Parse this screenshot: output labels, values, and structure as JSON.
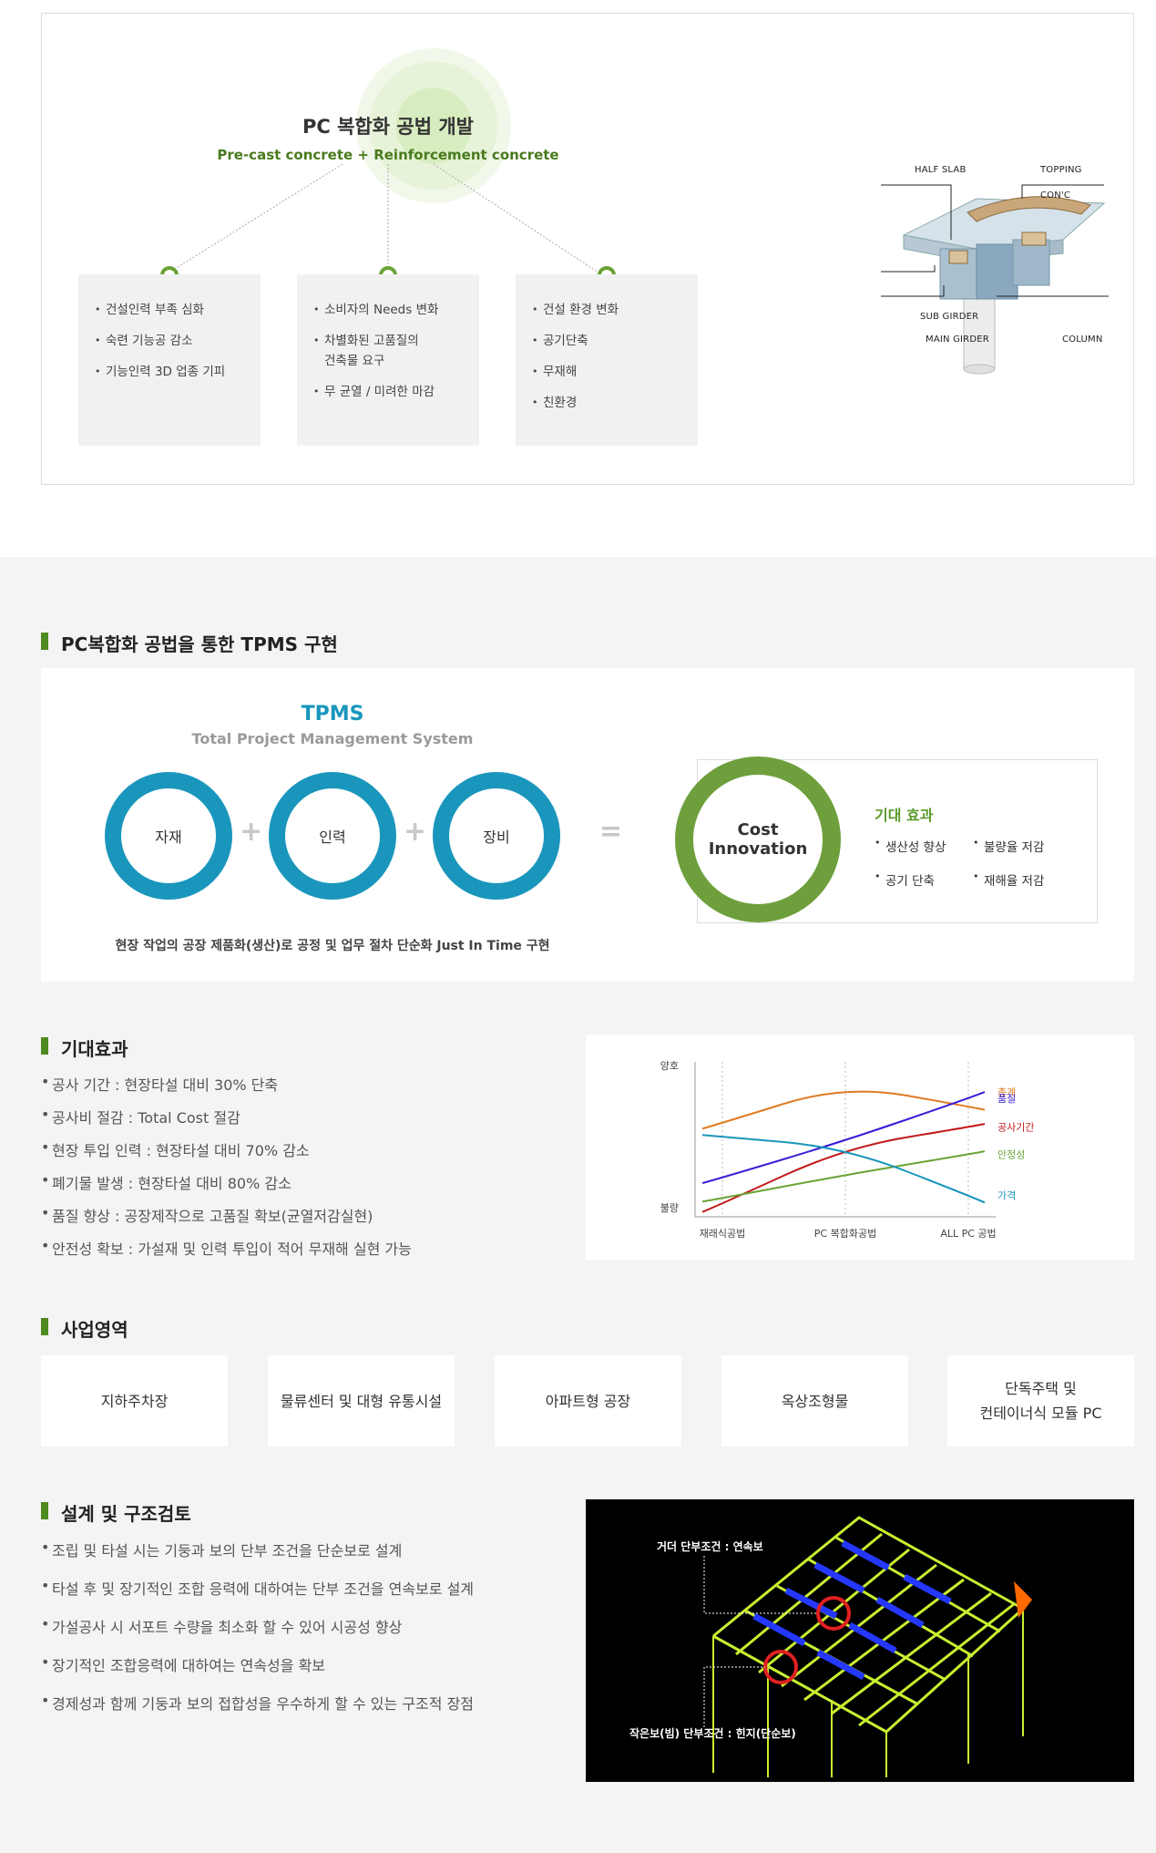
{
  "top": {
    "title": "PC 복합화 공법 개발",
    "subtitle": "Pre-cast concrete + Reinforcement concrete",
    "cards": [
      {
        "items": [
          "건설인력 부족 심화",
          "숙련 기능공 감소",
          "기능인력 3D 업종 기피"
        ]
      },
      {
        "items": [
          "소비자의 Needs 변화",
          "차별화된 고품질의\n건축물 요구",
          "무 균열 / 미려한 마감"
        ]
      },
      {
        "items": [
          "건설 환경 변화",
          "공기단축",
          "무재해",
          "친환경"
        ]
      }
    ],
    "diagram_labels": {
      "half_slab": "HALF SLAB",
      "topping": "TOPPING",
      "conc": "CON'C",
      "sub_girder": "SUB GIRDER",
      "main_girder": "MAIN GIRDER",
      "column": "COLUMN"
    }
  },
  "tpms": {
    "section_title": "PC복합화 공법을 통한 TPMS 구현",
    "title": "TPMS",
    "subtitle": "Total Project Management System",
    "rings": [
      "자재",
      "인력",
      "장비"
    ],
    "plus": "+",
    "equals": "=",
    "cost_line1": "Cost",
    "cost_line2": "Innovation",
    "effect_title": "기대 효과",
    "effects": [
      "생산성 향상",
      "불량율 저감",
      "공기 단축",
      "재해율 저감"
    ],
    "caption": "현장 작업의 공장 제품화(생산)로 공정 및 업무 절차 단순화 Just In Time 구현"
  },
  "expected": {
    "section_title": "기대효과",
    "items": [
      "공사 기간 : 현장타설 대비 30% 단축",
      "공사비 절감 : Total Cost 절감",
      "현장 투입 인력 : 현장타설 대비 70% 감소",
      "폐기물 발생 : 현장타설 대비 80% 감소",
      "품질 향상 : 공장제작으로 고품질 확보(균열저감실현)",
      "안전성 확보 : 가설재 및 인력 투입이 적어 무재해 실현 가능"
    ]
  },
  "chart_data": {
    "type": "line",
    "title": "",
    "xlabel": "",
    "ylabel": "",
    "y_top_label": "양호",
    "y_bottom_label": "불량",
    "categories": [
      "재래식공법",
      "PC 복합화공법",
      "ALL PC 공법"
    ],
    "ylim": [
      0,
      10
    ],
    "series": [
      {
        "name": "총계",
        "color": "#e07b22",
        "values": [
          6.2,
          9.0,
          7.4
        ]
      },
      {
        "name": "품질",
        "color": "#3a1fd6",
        "values": [
          2.2,
          4.9,
          8.0
        ]
      },
      {
        "name": "공사기간",
        "color": "#c11a1a",
        "values": [
          0.3,
          4.4,
          5.9
        ]
      },
      {
        "name": "안정성",
        "color": "#6aa336",
        "values": [
          0.7,
          2.4,
          3.9
        ]
      },
      {
        "name": "가격",
        "color": "#1a96bc",
        "values": [
          5.2,
          4.4,
          0.9
        ]
      }
    ]
  },
  "business": {
    "section_title": "사업영역",
    "items": [
      "지하주차장",
      "물류센터 및 대형 유통시설",
      "아파트형 공장",
      "옥상조형물",
      "단독주택 및\n컨테이너식 모듈 PC"
    ]
  },
  "design": {
    "section_title": "설계 및 구조검토",
    "items": [
      "조립 및 타설 시는 기둥과 보의 단부 조건을 단순보로 설계",
      "타설 후 및 장기적인 조합 응력에 대하여는 단부 조건을 연속보로 설계",
      "가설공사 시 서포트 수량을 최소화 할 수 있어 시공성 향상",
      "장기적인 조합응력에 대하여는 연속성을 확보",
      "경제성과 함께 기둥과 보의 접합성을 우수하게 할 수 있는 구조적 장점"
    ],
    "image_label_top": "거더 단부조건 : 연속보",
    "image_label_bottom": "작은보(빔) 단부조건 : 힌지(단순보)"
  }
}
